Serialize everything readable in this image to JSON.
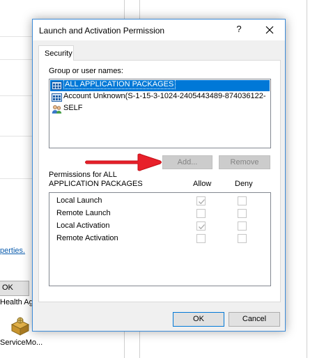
{
  "background": {
    "link_text": "perties.",
    "ok_label": "OK",
    "health_text": "Health Ag",
    "service_text": "ServiceMo..."
  },
  "dialog": {
    "title": "Launch and Activation Permission",
    "help_glyph": "?",
    "tab_label": "Security",
    "group_label": "Group or user names:",
    "users": [
      {
        "name": "ALL APPLICATION PACKAGES",
        "icon": "app-packages-icon",
        "selected": true
      },
      {
        "name": "Account Unknown(S-1-15-3-1024-2405443489-874036122-",
        "icon": "app-packages-icon",
        "selected": false
      },
      {
        "name": "SELF",
        "icon": "user-group-icon",
        "selected": false
      }
    ],
    "add_label": "Add...",
    "remove_label": "Remove",
    "permissions_for_line1": "Permissions for ALL",
    "permissions_for_line2": "APPLICATION PACKAGES",
    "allow_header": "Allow",
    "deny_header": "Deny",
    "permissions": [
      {
        "name": "Local Launch",
        "allow": true,
        "deny": false
      },
      {
        "name": "Remote Launch",
        "allow": false,
        "deny": false
      },
      {
        "name": "Local Activation",
        "allow": true,
        "deny": false
      },
      {
        "name": "Remote Activation",
        "allow": false,
        "deny": false
      }
    ],
    "ok_label": "OK",
    "cancel_label": "Cancel"
  },
  "colors": {
    "selection": "#0078d7",
    "annotation_arrow": "#e8202a",
    "dialog_border": "#3c8bd8"
  }
}
